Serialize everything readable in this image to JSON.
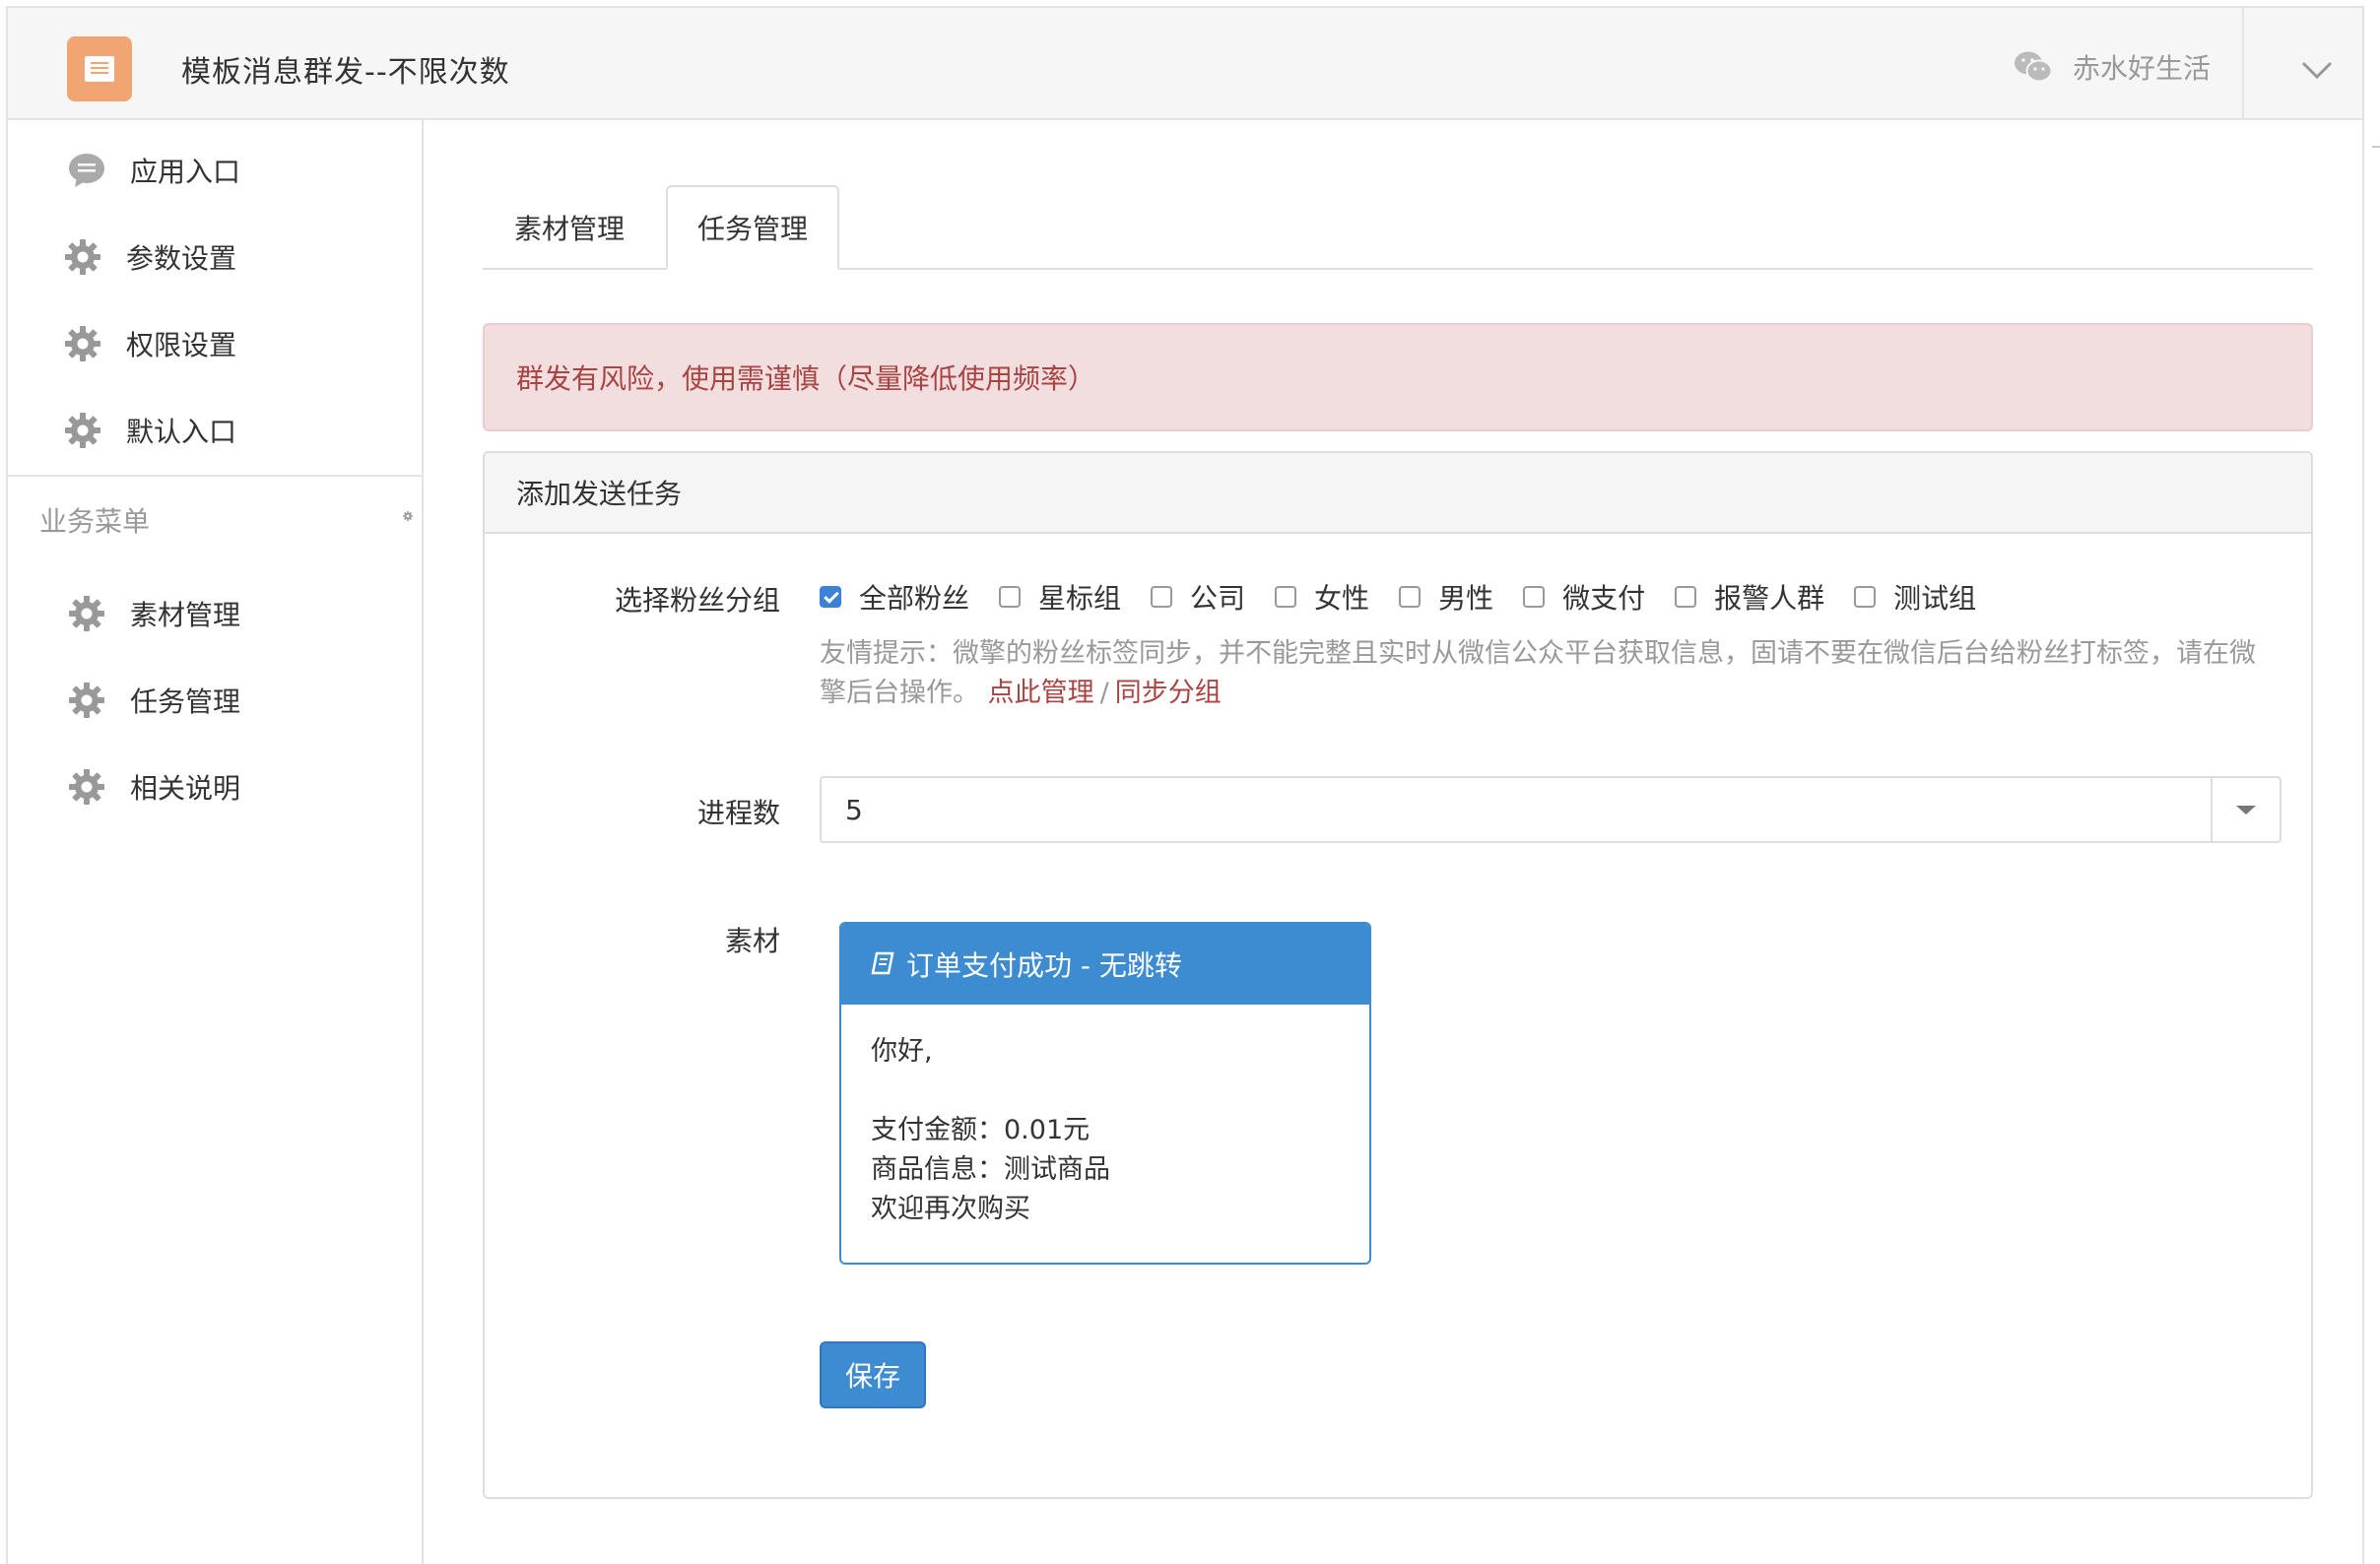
{
  "header": {
    "title": "模板消息群发--不限次数",
    "account_name": "赤水好生活"
  },
  "sidebar": {
    "items": [
      {
        "label": "应用入口",
        "icon": "chat-bubble-icon"
      },
      {
        "label": "参数设置",
        "icon": "gear-icon"
      },
      {
        "label": "权限设置",
        "icon": "gear-icon"
      },
      {
        "label": "默认入口",
        "icon": "gear-icon"
      }
    ],
    "section_title": "业务菜单",
    "business_items": [
      {
        "label": "素材管理",
        "icon": "gear-icon"
      },
      {
        "label": "任务管理",
        "icon": "gear-icon"
      },
      {
        "label": "相关说明",
        "icon": "gear-icon"
      }
    ]
  },
  "tabs": [
    {
      "label": "素材管理",
      "active": false
    },
    {
      "label": "任务管理",
      "active": true
    }
  ],
  "alert": {
    "text": "群发有风险，使用需谨慎（尽量降低使用频率）"
  },
  "panel": {
    "title": "添加发送任务",
    "fan_group": {
      "label": "选择粉丝分组",
      "options": [
        {
          "label": "全部粉丝",
          "checked": true
        },
        {
          "label": "星标组",
          "checked": false
        },
        {
          "label": "公司",
          "checked": false
        },
        {
          "label": "女性",
          "checked": false
        },
        {
          "label": "男性",
          "checked": false
        },
        {
          "label": "微支付",
          "checked": false
        },
        {
          "label": "报警人群",
          "checked": false
        },
        {
          "label": "测试组",
          "checked": false
        }
      ],
      "help_text": "友情提示：微擎的粉丝标签同步，并不能完整且实时从微信公众平台获取信息，固请不要在微信后台给粉丝打标签，请在微擎后台操作。",
      "link_manage": "点此管理",
      "link_separator": "/",
      "link_sync": "同步分组"
    },
    "process_count": {
      "label": "进程数",
      "value": "5"
    },
    "material": {
      "label": "素材",
      "card_title": "订单支付成功 - 无跳转",
      "card_body": "你好,\n\n支付金额：0.01元\n商品信息：测试商品\n欢迎再次购买"
    },
    "save_label": "保存"
  },
  "colors": {
    "accent": "#3d8bd1",
    "logo": "#f0a573",
    "alert_bg": "#f2dede",
    "alert_text": "#a94442"
  }
}
